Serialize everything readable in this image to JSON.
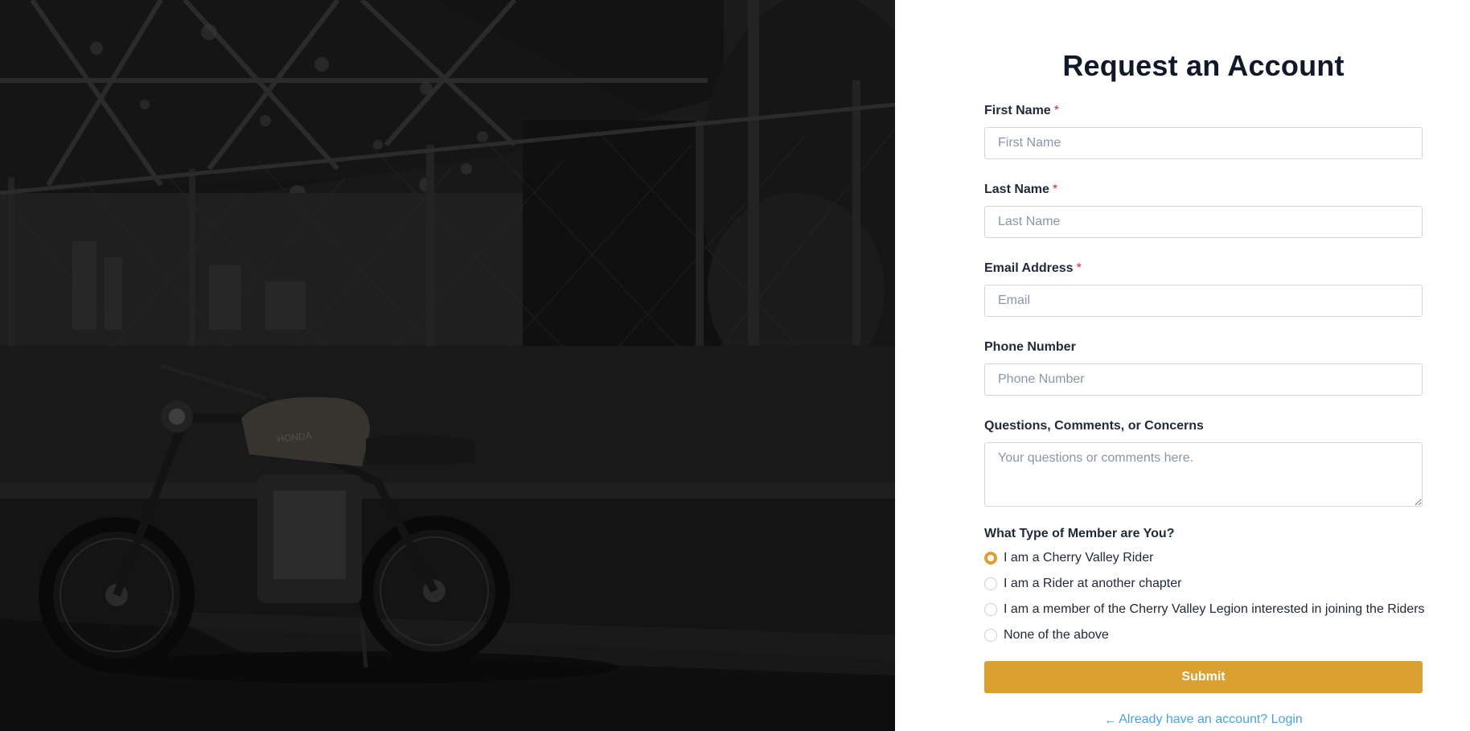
{
  "background": {
    "image": "motorcycle-under-bridge-photo",
    "tank_logo": "HONDA"
  },
  "form": {
    "title": "Request an Account",
    "fields": [
      {
        "label": "First Name",
        "required": true,
        "placeholder": "First Name",
        "value": ""
      },
      {
        "label": "Last Name",
        "required": true,
        "placeholder": "Last Name",
        "value": ""
      },
      {
        "label": "Email Address",
        "required": true,
        "placeholder": "Email",
        "value": ""
      },
      {
        "label": "Phone Number",
        "required": false,
        "placeholder": "Phone Number",
        "value": ""
      }
    ],
    "comments": {
      "label": "Questions, Comments, or Concerns",
      "placeholder": "Your questions or comments here.",
      "value": ""
    },
    "required_marker": "*",
    "member_type": {
      "label": "What Type of Member are You?",
      "options": [
        "I am a Cherry Valley Rider",
        "I am a Rider at another chapter",
        "I am a member of the Cherry Valley Legion interested in joining the Riders",
        "None of the above"
      ],
      "selected": "I am a Cherry Valley Rider"
    },
    "submit_label": "Submit",
    "login_link": {
      "arrow": "←",
      "text": "Already have an account? Login"
    }
  },
  "colors": {
    "accent": "#daa030",
    "link": "#4aa3df",
    "required": "#dc2626",
    "title": "#111827"
  },
  "icons": {
    "login_arrow": "arrow-left-icon",
    "radio_selected": "radio-checked-icon"
  }
}
